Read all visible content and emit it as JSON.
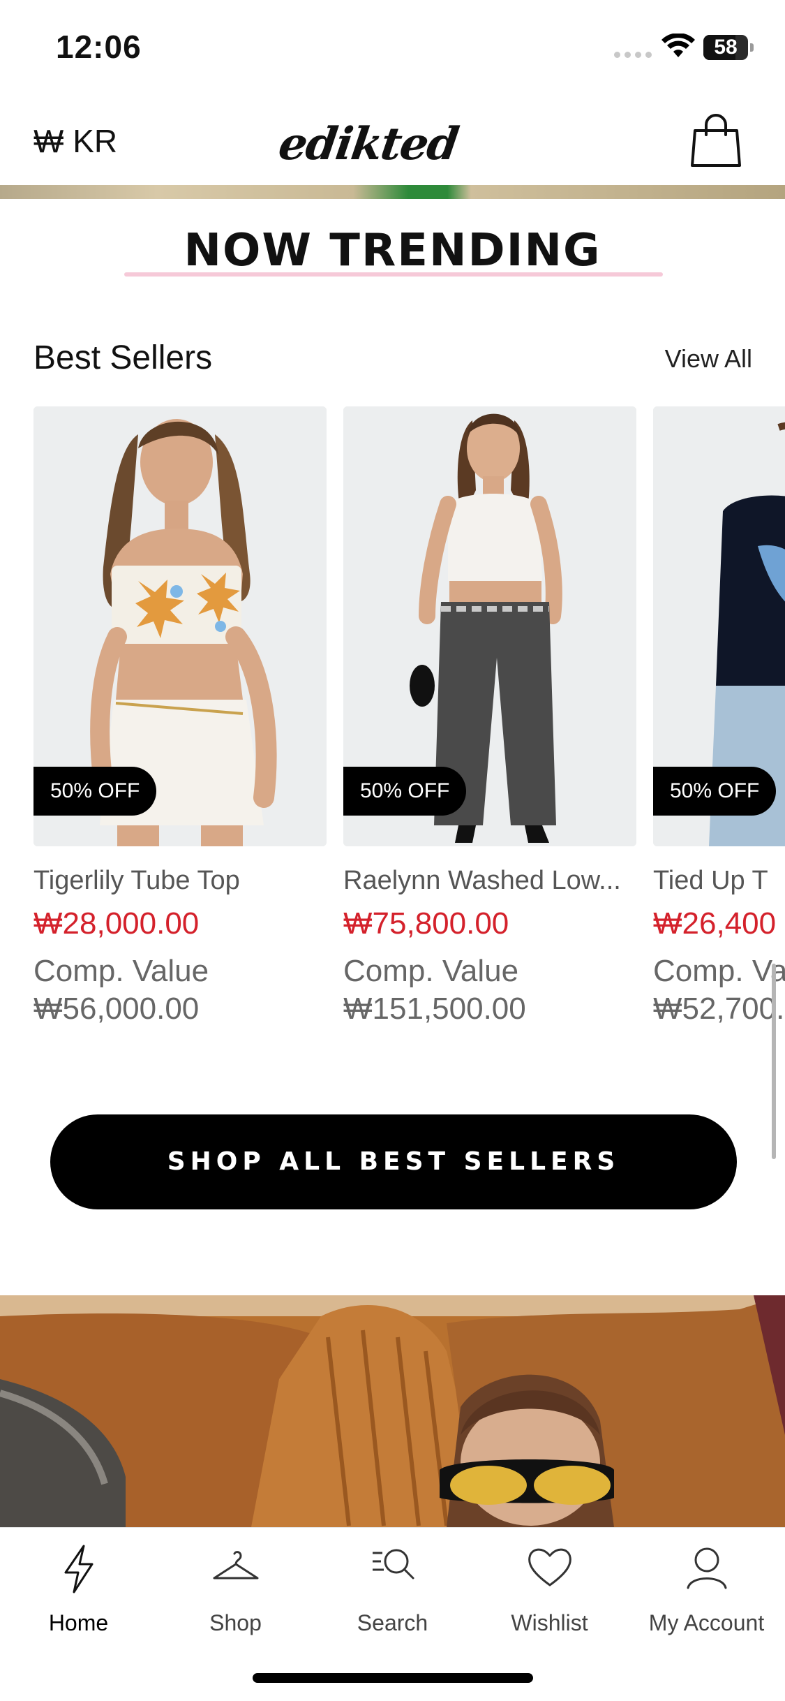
{
  "status_bar": {
    "time": "12:06",
    "battery": "58"
  },
  "header": {
    "currency": "₩ KR",
    "logo": "edikted",
    "bag_icon": "shopping-bag-icon"
  },
  "banner": {
    "title": "NOW TRENDING"
  },
  "best_sellers": {
    "title": "Best Sellers",
    "view_all": "View All",
    "products": [
      {
        "badge": "50% OFF",
        "name": "Tigerlily Tube Top",
        "price": "₩28,000.00",
        "comp_label": "Comp. Value",
        "comp_value": "₩56,000.00"
      },
      {
        "badge": "50% OFF",
        "name": "Raelynn Washed Low...",
        "price": "₩75,800.00",
        "comp_label": "Comp. Value",
        "comp_value": "₩151,500.00"
      },
      {
        "badge": "50% OFF",
        "name": "Tied Up T",
        "price": "₩26,400",
        "comp_label": "Comp. Va",
        "comp_value": "₩52,700."
      }
    ],
    "cta": "SHOP ALL BEST SELLERS"
  },
  "tab_bar": {
    "tabs": [
      {
        "label": "Home",
        "icon": "lightning-icon"
      },
      {
        "label": "Shop",
        "icon": "hanger-icon"
      },
      {
        "label": "Search",
        "icon": "search-icon"
      },
      {
        "label": "Wishlist",
        "icon": "heart-icon"
      },
      {
        "label": "My Account",
        "icon": "user-icon"
      }
    ],
    "active": "Home"
  }
}
